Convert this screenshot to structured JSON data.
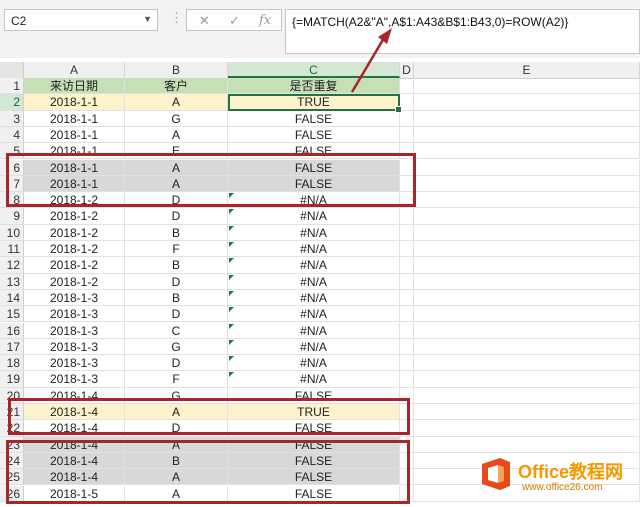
{
  "namebox": {
    "value": "C2"
  },
  "formula_bar": {
    "cancel_icon": "✕",
    "enter_icon": "✓",
    "fx_icon": "fx",
    "formula": "{=MATCH(A2&\"A\",A$1:A43&B$1:B43,0)=ROW(A2)}"
  },
  "columns": [
    "A",
    "B",
    "C",
    "D",
    "E"
  ],
  "header_row": {
    "row": "1",
    "a": "来访日期",
    "b": "客户",
    "c": "是否重复"
  },
  "rows": [
    {
      "row": "2",
      "a": "2018-1-1",
      "b": "A",
      "c": "TRUE",
      "style": "yellow",
      "tri": false
    },
    {
      "row": "3",
      "a": "2018-1-1",
      "b": "G",
      "c": "FALSE",
      "style": "",
      "tri": false
    },
    {
      "row": "4",
      "a": "2018-1-1",
      "b": "A",
      "c": "FALSE",
      "style": "",
      "tri": false
    },
    {
      "row": "5",
      "a": "2018-1-1",
      "b": "E",
      "c": "FALSE",
      "style": "",
      "tri": false
    },
    {
      "row": "6",
      "a": "2018-1-1",
      "b": "A",
      "c": "FALSE",
      "style": "gray",
      "tri": false
    },
    {
      "row": "7",
      "a": "2018-1-1",
      "b": "A",
      "c": "FALSE",
      "style": "gray",
      "tri": false
    },
    {
      "row": "8",
      "a": "2018-1-2",
      "b": "D",
      "c": "#N/A",
      "style": "",
      "tri": true
    },
    {
      "row": "9",
      "a": "2018-1-2",
      "b": "D",
      "c": "#N/A",
      "style": "",
      "tri": true
    },
    {
      "row": "10",
      "a": "2018-1-2",
      "b": "B",
      "c": "#N/A",
      "style": "",
      "tri": true
    },
    {
      "row": "11",
      "a": "2018-1-2",
      "b": "F",
      "c": "#N/A",
      "style": "",
      "tri": true
    },
    {
      "row": "12",
      "a": "2018-1-2",
      "b": "B",
      "c": "#N/A",
      "style": "",
      "tri": true
    },
    {
      "row": "13",
      "a": "2018-1-2",
      "b": "D",
      "c": "#N/A",
      "style": "",
      "tri": true
    },
    {
      "row": "14",
      "a": "2018-1-3",
      "b": "B",
      "c": "#N/A",
      "style": "",
      "tri": true
    },
    {
      "row": "15",
      "a": "2018-1-3",
      "b": "D",
      "c": "#N/A",
      "style": "",
      "tri": true
    },
    {
      "row": "16",
      "a": "2018-1-3",
      "b": "C",
      "c": "#N/A",
      "style": "",
      "tri": true
    },
    {
      "row": "17",
      "a": "2018-1-3",
      "b": "G",
      "c": "#N/A",
      "style": "",
      "tri": true
    },
    {
      "row": "18",
      "a": "2018-1-3",
      "b": "D",
      "c": "#N/A",
      "style": "",
      "tri": true
    },
    {
      "row": "19",
      "a": "2018-1-3",
      "b": "F",
      "c": "#N/A",
      "style": "",
      "tri": true
    },
    {
      "row": "20",
      "a": "2018-1-4",
      "b": "G",
      "c": "FALSE",
      "style": "",
      "tri": false
    },
    {
      "row": "21",
      "a": "2018-1-4",
      "b": "A",
      "c": "TRUE",
      "style": "yellow",
      "tri": false
    },
    {
      "row": "22",
      "a": "2018-1-4",
      "b": "D",
      "c": "FALSE",
      "style": "",
      "tri": false
    },
    {
      "row": "23",
      "a": "2018-1-4",
      "b": "A",
      "c": "FALSE",
      "style": "gray",
      "tri": false
    },
    {
      "row": "24",
      "a": "2018-1-4",
      "b": "B",
      "c": "FALSE",
      "style": "gray",
      "tri": false
    },
    {
      "row": "25",
      "a": "2018-1-4",
      "b": "A",
      "c": "FALSE",
      "style": "gray",
      "tri": false
    },
    {
      "row": "26",
      "a": "2018-1-5",
      "b": "A",
      "c": "FALSE",
      "style": "",
      "tri": false
    }
  ],
  "watermark": {
    "title": "Office教程网",
    "url": "www.office26.com"
  },
  "colors": {
    "excel_green": "#217346",
    "annotation_red": "#a8262b",
    "true_highlight": "#fdf2cc",
    "dup_highlight": "#d8d8d8"
  }
}
